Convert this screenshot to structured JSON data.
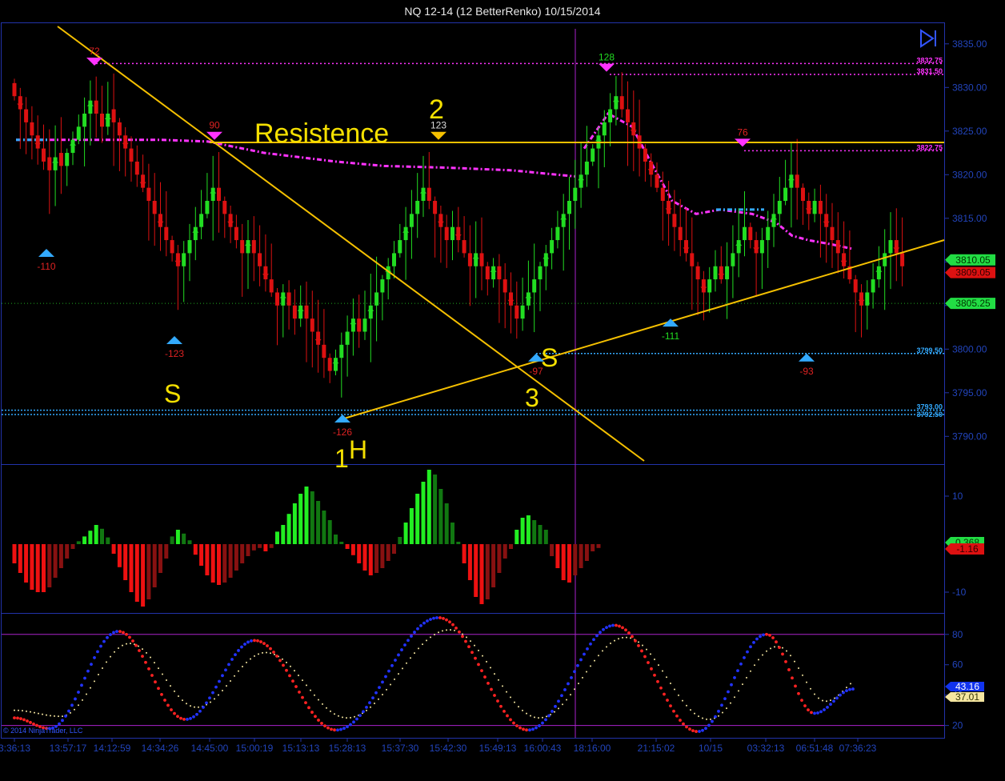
{
  "window": {
    "title": "NQ 12-14 (12 BetterRenko)  10/15/2014",
    "copyright": "© 2014 NinjaTrader, LLC"
  },
  "colors": {
    "background": "#000000",
    "panel_border": "#2233aa",
    "up_bar": "#22dd22",
    "down_bar": "#dd1111",
    "magenta": "#ff33ff",
    "cyan": "#33aaff",
    "yellow": "#f5c000"
  },
  "chart_data": [
    {
      "type": "candlestick",
      "panel": "price",
      "ylim": [
        3787,
        3837
      ],
      "y_ticks": [
        3790,
        3795,
        3800,
        3805,
        3810,
        3815,
        3820,
        3825,
        3830,
        3835
      ],
      "y_tick_labels": [
        "3790.00",
        "3795.00",
        "3800.00",
        "3805.00",
        "3810.00",
        "3815.00",
        "3820.00",
        "3825.00",
        "3830.00",
        "3835.00"
      ],
      "closes": [
        3829,
        3827.5,
        3826,
        3824.5,
        3823,
        3821.5,
        3820.5,
        3822,
        3821,
        3822.5,
        3824,
        3825.5,
        3827,
        3828.5,
        3827,
        3825.5,
        3827,
        3826,
        3824.5,
        3823,
        3821.5,
        3820,
        3818.5,
        3817,
        3815.5,
        3814,
        3812.5,
        3811,
        3809.5,
        3811,
        3812.5,
        3814,
        3815.5,
        3817,
        3818.5,
        3817,
        3815.5,
        3814,
        3812.5,
        3811,
        3812.5,
        3811,
        3809.5,
        3808,
        3806.5,
        3805,
        3806.5,
        3805,
        3803.5,
        3805,
        3803.5,
        3802,
        3800.5,
        3799,
        3797.5,
        3799,
        3800.5,
        3802,
        3803.5,
        3802,
        3803.5,
        3805,
        3806.5,
        3808,
        3809.5,
        3811,
        3812.5,
        3814,
        3815.5,
        3817,
        3818.5,
        3817,
        3815.5,
        3814,
        3812.5,
        3814,
        3812.5,
        3811,
        3809.5,
        3811,
        3809.5,
        3808,
        3809.5,
        3808,
        3806.5,
        3805,
        3803.5,
        3805,
        3806.5,
        3808,
        3809.5,
        3811,
        3812.5,
        3814,
        3815.5,
        3817,
        3818.5,
        3820,
        3821.5,
        3823,
        3824.5,
        3826,
        3827.5,
        3829,
        3827.5,
        3826,
        3824.5,
        3823,
        3821.5,
        3820,
        3818.5,
        3817,
        3815.5,
        3814,
        3812.5,
        3811,
        3809.5,
        3808,
        3806.5,
        3808,
        3809.5,
        3808,
        3809.5,
        3811,
        3812.5,
        3814,
        3812.5,
        3811,
        3812.5,
        3814,
        3815.5,
        3817,
        3818.5,
        3820,
        3818.5,
        3817,
        3815.5,
        3817,
        3815.5,
        3814,
        3812.5,
        3811,
        3809.5,
        3808,
        3806.5,
        3805,
        3806.5,
        3808,
        3809.5,
        3811,
        3812.5,
        3811,
        3809.5
      ],
      "labels": [
        "3:36:13",
        "13:57:17",
        "14:12:59",
        "14:34:26",
        "14:45:00",
        "15:00:19",
        "15:13:13",
        "15:28:13",
        "15:37:30",
        "15:42:30",
        "15:49:13",
        "16:00:43",
        "18:16:00",
        "21:15:02",
        "10/15",
        "03:32:13",
        "06:51:48",
        "07:36:23"
      ],
      "price_tags": [
        "3810.05",
        "3809.05",
        "3805.25"
      ],
      "levels": [
        "3832.75",
        "3831.50",
        "3822.75",
        "3799.50",
        "3793.00",
        "3792.50"
      ],
      "swing_labels": [
        "72",
        "-110",
        "90",
        "-123",
        "123",
        "-126",
        "-97",
        "128",
        "-111",
        "76",
        "-93"
      ],
      "annotations": [
        "Resistence",
        "2",
        "S",
        "S",
        "3",
        "1",
        "H"
      ]
    },
    {
      "type": "bar",
      "panel": "histogram",
      "ylim": [
        -14,
        16
      ],
      "y_tick_labels": [
        "10",
        "-10"
      ],
      "values": [
        -4,
        -6,
        -8,
        -9.5,
        -10,
        -10,
        -9,
        -7,
        -5,
        -3,
        -1,
        0.6,
        1.6,
        2.8,
        4,
        3.2,
        1.4,
        -2,
        -4.8,
        -7.5,
        -10,
        -12,
        -13,
        -11.5,
        -9,
        -6,
        -3,
        1.6,
        3,
        2.2,
        0.8,
        -2.2,
        -4.5,
        -6.5,
        -8,
        -8.5,
        -8,
        -7,
        -5.5,
        -4,
        -2.5,
        -1.3,
        -0.8,
        -1.5,
        -0.8,
        2.6,
        4,
        6.3,
        8.5,
        10.5,
        12,
        11,
        9,
        7,
        5,
        2,
        0.5,
        -1,
        -2.3,
        -4,
        -5.5,
        -6.5,
        -6,
        -5,
        -3.5,
        -2,
        1.5,
        4.5,
        7.5,
        10.5,
        13,
        15.5,
        14.5,
        11.5,
        8.5,
        4.5,
        0.5,
        -4,
        -7.5,
        -11,
        -12.5,
        -11.5,
        -9,
        -6,
        -3,
        -1,
        3,
        5.5,
        6,
        5,
        4,
        3,
        -2.5,
        -5,
        -7.5,
        -8,
        -6.5,
        -5,
        -3.5,
        -1.5,
        -0.8
      ],
      "value_tags": [
        "0.368",
        "-1.16"
      ]
    },
    {
      "type": "line",
      "panel": "oscillator",
      "ylim": [
        14,
        92
      ],
      "y_tick_labels": [
        "80",
        "60",
        "40",
        "20"
      ],
      "levels": [
        80,
        20
      ],
      "value_tags": [
        "43.16",
        "37.01"
      ]
    }
  ]
}
